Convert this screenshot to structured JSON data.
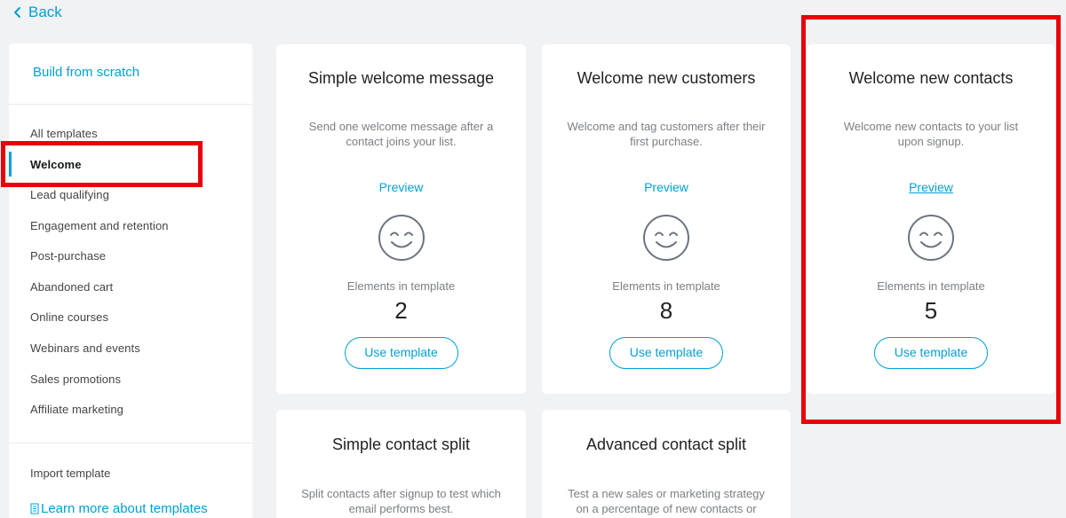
{
  "nav": {
    "back_label": "Back"
  },
  "sidebar": {
    "build_label": "Build from scratch",
    "categories": [
      {
        "label": "All templates"
      },
      {
        "label": "Welcome"
      },
      {
        "label": "Lead qualifying"
      },
      {
        "label": "Engagement and retention"
      },
      {
        "label": "Post-purchase"
      },
      {
        "label": "Abandoned cart"
      },
      {
        "label": "Online courses"
      },
      {
        "label": "Webinars and events"
      },
      {
        "label": "Sales promotions"
      },
      {
        "label": "Affiliate marketing"
      }
    ],
    "active_category": "Welcome",
    "import_label": "Import template",
    "learn_label": "Learn more about templates"
  },
  "cards": [
    {
      "title": "Simple welcome message",
      "description": "Send one welcome message after a contact joins your list.",
      "preview_label": "Preview",
      "elements_label": "Elements in template",
      "elements_count": "2",
      "button_label": "Use template"
    },
    {
      "title": "Welcome new customers",
      "description": "Welcome and tag customers after their first purchase.",
      "preview_label": "Preview",
      "elements_label": "Elements in template",
      "elements_count": "8",
      "button_label": "Use template"
    },
    {
      "title": "Welcome new contacts",
      "description": "Welcome new contacts to your list upon signup.",
      "preview_label": "Preview",
      "elements_label": "Elements in template",
      "elements_count": "5",
      "button_label": "Use template"
    },
    {
      "title": "Simple contact split",
      "description": "Split contacts after signup to test which email performs best."
    },
    {
      "title": "Advanced contact split",
      "description": "Test a new sales or marketing strategy on a percentage of new contacts or"
    }
  ],
  "colors": {
    "accent": "#00a1d6",
    "highlight": "#e8000b",
    "background": "#f1f2f3"
  },
  "icons": {
    "back": "chevron-left-icon",
    "template": "smiley-face-icon",
    "learn": "document-icon"
  }
}
